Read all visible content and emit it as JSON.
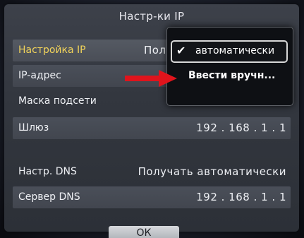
{
  "dialog": {
    "title": "Настр-ки IP"
  },
  "rows": [
    {
      "label": "Настройка IP",
      "value": "Пол"
    },
    {
      "label": "IP-адрес",
      "value": ""
    },
    {
      "label": "Маска подсети",
      "value": ""
    },
    {
      "label": "Шлюз",
      "value": "192 . 168 . 1 . 1"
    },
    {
      "label": "Настр. DNS",
      "value": "Получать автоматически"
    },
    {
      "label": "Сервер DNS",
      "value": "192 . 168 . 1 . 1"
    }
  ],
  "dropdown": {
    "selected_option": "автоматически",
    "other_option": "Ввести вручн..."
  },
  "ok_label": "ОК",
  "colors": {
    "selected_label": "#f2d45a",
    "arrow": "#e0141c"
  },
  "icons": {
    "check": "check-icon",
    "pointer": "red-arrow-icon"
  }
}
